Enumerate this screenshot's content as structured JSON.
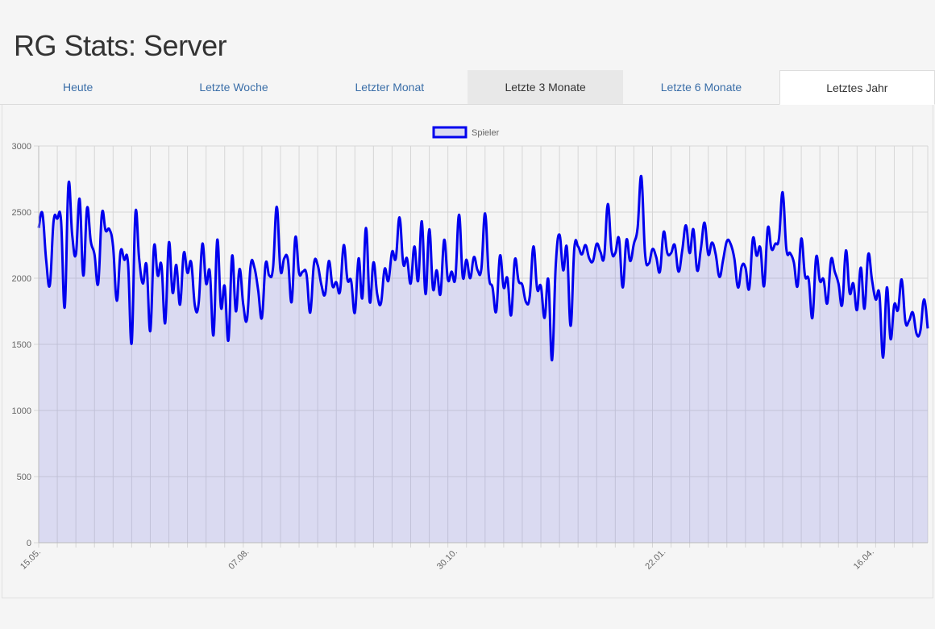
{
  "page": {
    "title": "RG Stats: Server"
  },
  "tabs": [
    {
      "label": "Heute"
    },
    {
      "label": "Letzte Woche"
    },
    {
      "label": "Letzter Monat"
    },
    {
      "label": "Letzte 3 Monate"
    },
    {
      "label": "Letzte 6 Monate"
    },
    {
      "label": "Letztes Jahr"
    }
  ],
  "chart_data": {
    "type": "area",
    "series": [
      {
        "name": "Spieler",
        "color": "#0000ee",
        "fill": "rgba(100,100,230,0.18)",
        "values": [
          2380,
          2490,
          2140,
          1950,
          2430,
          2450,
          2440,
          1780,
          2710,
          2330,
          2180,
          2600,
          2020,
          2530,
          2280,
          2180,
          1960,
          2490,
          2360,
          2370,
          2240,
          1830,
          2200,
          2140,
          2120,
          1510,
          2490,
          2150,
          1960,
          2100,
          1600,
          2240,
          2020,
          2100,
          1660,
          2270,
          1890,
          2100,
          1800,
          2190,
          2040,
          2120,
          1790,
          1810,
          2260,
          1960,
          2050,
          1570,
          2290,
          1780,
          1940,
          1530,
          2170,
          1750,
          2070,
          1800,
          1690,
          2100,
          2080,
          1910,
          1700,
          2110,
          2020,
          2080,
          2540,
          2060,
          2150,
          2140,
          1820,
          2310,
          2040,
          2050,
          2030,
          1740,
          2110,
          2100,
          1950,
          1880,
          2130,
          1940,
          1970,
          1900,
          2250,
          1990,
          1980,
          1740,
          2150,
          1850,
          2380,
          1820,
          2120,
          1880,
          1810,
          2070,
          1980,
          2200,
          2150,
          2460,
          2110,
          2150,
          1960,
          2240,
          1980,
          2430,
          1880,
          2370,
          1920,
          2060,
          1880,
          2290,
          1990,
          2050,
          2000,
          2480,
          2010,
          2140,
          2000,
          2160,
          2060,
          2070,
          2490,
          2020,
          1930,
          1750,
          2170,
          1930,
          2000,
          1720,
          2140,
          1980,
          1950,
          1820,
          1860,
          2240,
          1920,
          1940,
          1700,
          1990,
          1380,
          2100,
          2330,
          2060,
          2230,
          1640,
          2230,
          2240,
          2180,
          2250,
          2150,
          2130,
          2260,
          2200,
          2160,
          2560,
          2210,
          2190,
          2300,
          1930,
          2290,
          2130,
          2260,
          2380,
          2770,
          2190,
          2110,
          2220,
          2160,
          2050,
          2350,
          2190,
          2190,
          2250,
          2050,
          2210,
          2400,
          2190,
          2370,
          2060,
          2220,
          2420,
          2180,
          2270,
          2180,
          2010,
          2140,
          2280,
          2260,
          2150,
          1930,
          2090,
          2080,
          1920,
          2300,
          2170,
          2230,
          1940,
          2380,
          2220,
          2260,
          2300,
          2650,
          2220,
          2190,
          2120,
          1940,
          2300,
          2020,
          1990,
          1700,
          2160,
          1980,
          1990,
          1810,
          2140,
          2050,
          1960,
          1800,
          2210,
          1890,
          1960,
          1760,
          2080,
          1770,
          2180,
          1990,
          1840,
          1880,
          1400,
          1930,
          1540,
          1800,
          1760,
          1990,
          1670,
          1680,
          1740,
          1580,
          1600,
          1840,
          1620
        ],
        "visible_area": true
      }
    ],
    "x_tick_labels": [
      "15.05.",
      "07.08.",
      "30.10.",
      "22.01.",
      "16.04."
    ],
    "y_ticks": [
      0,
      500,
      1000,
      1500,
      2000,
      2500,
      3000
    ],
    "ylim": [
      0,
      3000
    ],
    "legend": {
      "label": "Spieler",
      "position": "top-center"
    },
    "grid": true
  }
}
